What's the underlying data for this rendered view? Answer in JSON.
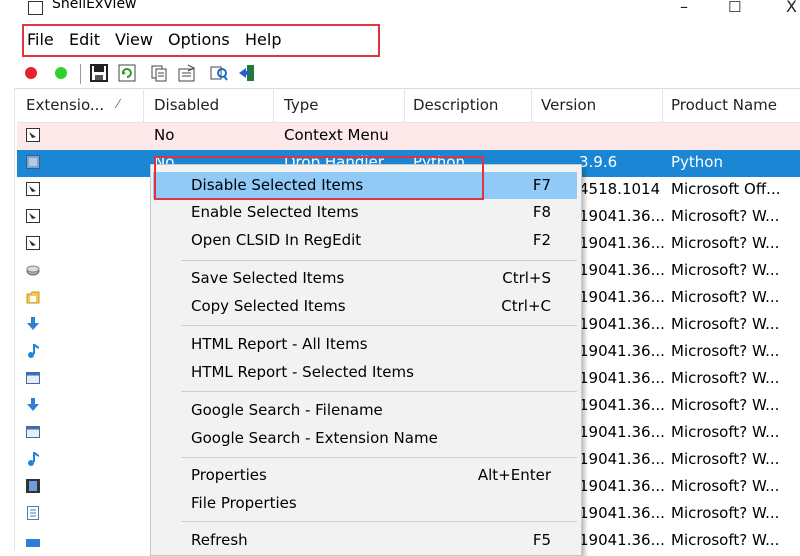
{
  "window": {
    "title": "ShellExView",
    "min_glyph": "–",
    "max_glyph": "☐",
    "close_glyph": "X"
  },
  "menubar": {
    "items": [
      "File",
      "Edit",
      "View",
      "Options",
      "Help"
    ]
  },
  "toolbar": {
    "icons": [
      "red-dot-icon",
      "green-dot-icon",
      "save-icon",
      "refresh-icon",
      "copy-icon",
      "properties-icon",
      "search-icon",
      "exit-icon"
    ]
  },
  "table": {
    "columns": [
      "Extensio...",
      "Disabled",
      "Type",
      "Description",
      "Version",
      "Product Name"
    ],
    "sort_glyph": "⁄",
    "rows": [
      {
        "disabled": "No",
        "type": "Context Menu",
        "description": "",
        "version": "",
        "product": ""
      },
      {
        "disabled": "No",
        "type": "Drop Handler",
        "description": "Python",
        "version": "3.9.6",
        "product": "Python"
      },
      {
        "disabled": "",
        "type": "",
        "description": "",
        "version": "4518.1014",
        "product": "Microsoft Off..."
      },
      {
        "disabled": "",
        "type": "",
        "description": "",
        "version": "19041.36...",
        "product": "Microsoft? W..."
      },
      {
        "disabled": "",
        "type": "",
        "description": "",
        "version": "19041.36...",
        "product": "Microsoft? W..."
      },
      {
        "disabled": "",
        "type": "",
        "description": "",
        "version": "19041.36...",
        "product": "Microsoft? W..."
      },
      {
        "disabled": "",
        "type": "",
        "description": "",
        "version": "19041.36...",
        "product": "Microsoft? W..."
      },
      {
        "disabled": "",
        "type": "",
        "description": "",
        "version": "19041.36...",
        "product": "Microsoft? W..."
      },
      {
        "disabled": "",
        "type": "",
        "description": "",
        "version": "19041.36...",
        "product": "Microsoft? W..."
      },
      {
        "disabled": "",
        "type": "",
        "description": "",
        "version": "19041.36...",
        "product": "Microsoft? W..."
      },
      {
        "disabled": "",
        "type": "",
        "description": "",
        "version": "19041.36...",
        "product": "Microsoft? W..."
      },
      {
        "disabled": "",
        "type": "",
        "description": "",
        "version": "19041.36...",
        "product": "Microsoft? W..."
      },
      {
        "disabled": "",
        "type": "",
        "description": "",
        "version": "19041.36...",
        "product": "Microsoft? W..."
      },
      {
        "disabled": "",
        "type": "",
        "description": "",
        "version": "19041.36...",
        "product": "Microsoft? W..."
      },
      {
        "disabled": "",
        "type": "",
        "description": "",
        "version": "19041.36...",
        "product": "Microsoft? W..."
      },
      {
        "disabled": "",
        "type": "",
        "description": "",
        "version": "19041.36...",
        "product": "Microsoft? W..."
      }
    ],
    "row_icons": [
      "shell-doc-icon",
      "python-file-icon",
      "shell-doc-icon",
      "shell-doc-icon",
      "shell-doc-icon",
      "drive-icon",
      "folder-icon",
      "down-arrow-icon",
      "music-note-icon",
      "window-icon",
      "down-arrow-icon",
      "window-icon",
      "music-note-icon",
      "film-icon",
      "document-icon",
      "blue-bar-icon"
    ]
  },
  "context_menu": {
    "items": [
      {
        "label": "Disable Selected Items",
        "shortcut": "F7"
      },
      {
        "label": "Enable Selected Items",
        "shortcut": "F8"
      },
      {
        "label": "Open CLSID In RegEdit",
        "shortcut": "F2"
      },
      {
        "label": "Save Selected Items",
        "shortcut": "Ctrl+S"
      },
      {
        "label": "Copy Selected Items",
        "shortcut": "Ctrl+C"
      },
      {
        "label": "HTML Report - All Items",
        "shortcut": ""
      },
      {
        "label": "HTML Report - Selected Items",
        "shortcut": ""
      },
      {
        "label": "Google Search - Filename",
        "shortcut": ""
      },
      {
        "label": "Google Search - Extension Name",
        "shortcut": ""
      },
      {
        "label": "Properties",
        "shortcut": "Alt+Enter"
      },
      {
        "label": "File Properties",
        "shortcut": ""
      },
      {
        "label": "Refresh",
        "shortcut": "F5"
      }
    ]
  },
  "colors": {
    "annotation_red": "#e0333f",
    "selection_blue": "#1a86d4",
    "menu_hover": "#91c9f7",
    "pink_row": "#fde8ea"
  }
}
